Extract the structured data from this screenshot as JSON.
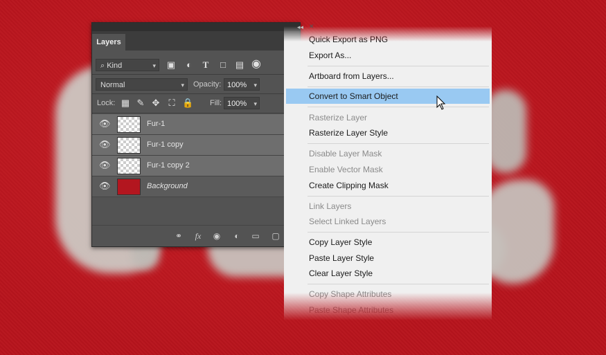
{
  "panel": {
    "topbar_collapse": "◂◂",
    "topbar_close": "✕",
    "tab_label": "Layers",
    "menu_icon": "≡",
    "filter_label": "⌕ Kind",
    "blend_mode": "Normal",
    "opacity_label": "Opacity:",
    "opacity_value": "100%",
    "lock_label": "Lock:",
    "fill_label": "Fill:",
    "fill_value": "100%",
    "layers": [
      {
        "name": "Fur-1",
        "thumb": "transparent"
      },
      {
        "name": "Fur-1 copy",
        "thumb": "transparent"
      },
      {
        "name": "Fur-1 copy 2",
        "thumb": "transparent"
      },
      {
        "name": "Background",
        "thumb": "red"
      }
    ],
    "bottom_icons": [
      "link-icon",
      "fx-icon",
      "mask-icon",
      "adjustment-icon",
      "folder-icon",
      "new-layer-icon"
    ]
  },
  "context_menu": {
    "items": [
      {
        "label": "Quick Export as PNG",
        "state": "enabled"
      },
      {
        "label": "Export As...",
        "state": "enabled"
      },
      {
        "label": "Artboard from Layers...",
        "state": "enabled"
      },
      {
        "label": "Convert to Smart Object",
        "state": "highlighted"
      },
      {
        "label": "Rasterize Layer",
        "state": "disabled"
      },
      {
        "label": "Rasterize Layer Style",
        "state": "enabled"
      },
      {
        "label": "Disable Layer Mask",
        "state": "disabled"
      },
      {
        "label": "Enable Vector Mask",
        "state": "disabled"
      },
      {
        "label": "Create Clipping Mask",
        "state": "enabled"
      },
      {
        "label": "Link Layers",
        "state": "disabled"
      },
      {
        "label": "Select Linked Layers",
        "state": "disabled"
      },
      {
        "label": "Copy Layer Style",
        "state": "enabled"
      },
      {
        "label": "Paste Layer Style",
        "state": "enabled"
      },
      {
        "label": "Clear Layer Style",
        "state": "enabled"
      },
      {
        "label": "Copy Shape Attributes",
        "state": "disabled"
      },
      {
        "label": "Paste Shape Attributes",
        "state": "disabled"
      }
    ]
  },
  "colors": {
    "background_red": "#b8141d",
    "panel_gray": "#535353",
    "menu_bg": "#f0f0f0",
    "highlight_blue": "#99c9f2"
  }
}
